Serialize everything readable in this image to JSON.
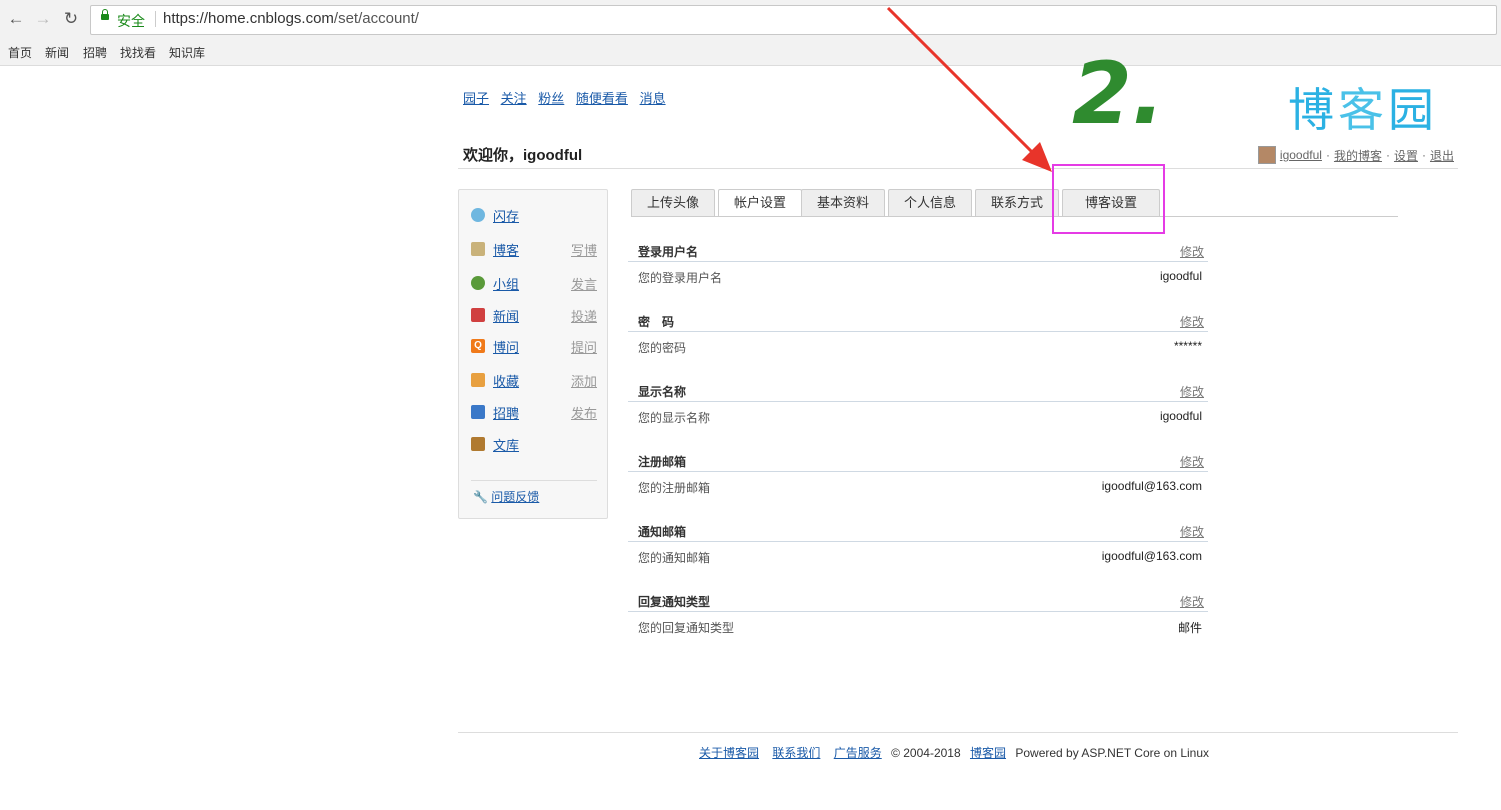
{
  "browser": {
    "secure_label": "安全",
    "url_host": "https://home.cnblogs.com",
    "url_path": "/set/account/",
    "bookmarks": [
      "首页",
      "新闻",
      "招聘",
      "找找看",
      "知识库"
    ]
  },
  "topnav": [
    "园子",
    "关注",
    "粉丝",
    "随便看看",
    "消息"
  ],
  "logo": {
    "chars": [
      "博",
      "客",
      "园"
    ],
    "color": "#2bb1e3"
  },
  "welcome": "欢迎你，igoodful",
  "user_links": {
    "username": "igoodful",
    "my_blog": "我的博客",
    "settings": "设置",
    "logout": "退出",
    "separator": "·"
  },
  "sidebar": {
    "items": [
      {
        "label": "闪存",
        "action": "",
        "icon": "chat-bubble-icon",
        "color": "#6fb7e0"
      },
      {
        "label": "博客",
        "action": "写博",
        "icon": "pencil-note-icon",
        "color": "#c9b27a"
      },
      {
        "label": "小组",
        "action": "发言",
        "icon": "group-icon",
        "color": "#5a9a3a"
      },
      {
        "label": "新闻",
        "action": "投递",
        "icon": "news-icon",
        "color": "#d04040"
      },
      {
        "label": "博问",
        "action": "提问",
        "icon": "question-icon",
        "color": "#f07a1a"
      },
      {
        "label": "收藏",
        "action": "添加",
        "icon": "heart-folder-icon",
        "color": "#e8a040"
      },
      {
        "label": "招聘",
        "action": "发布",
        "icon": "person-card-icon",
        "color": "#3a78c8"
      },
      {
        "label": "文库",
        "action": "",
        "icon": "book-icon",
        "color": "#b07a30"
      }
    ],
    "feedback": "问题反馈"
  },
  "tabs": [
    {
      "label": "上传头像",
      "active": false
    },
    {
      "label": "帐户设置",
      "active": true
    },
    {
      "label": "基本资料",
      "active": false
    },
    {
      "label": "个人信息",
      "active": false
    },
    {
      "label": "联系方式",
      "active": false
    },
    {
      "label": "博客设置",
      "active": false
    }
  ],
  "settings": [
    {
      "title": "登录用户名",
      "edit": "修改",
      "desc": "您的登录用户名",
      "value": "igoodful"
    },
    {
      "title": "密　码",
      "edit": "修改",
      "desc": "您的密码",
      "value": "******"
    },
    {
      "title": "显示名称",
      "edit": "修改",
      "desc": "您的显示名称",
      "value": "igoodful"
    },
    {
      "title": "注册邮箱",
      "edit": "修改",
      "desc": "您的注册邮箱",
      "value": "igoodful@163.com"
    },
    {
      "title": "通知邮箱",
      "edit": "修改",
      "desc": "您的通知邮箱",
      "value": "igoodful@163.com"
    },
    {
      "title": "回复通知类型",
      "edit": "修改",
      "desc": "您的回复通知类型",
      "value": "邮件"
    }
  ],
  "footer": {
    "about": "关于博客园",
    "contact": "联系我们",
    "ads": "广告服务",
    "copyright": "© 2004-2018",
    "site": "博客园",
    "powered": "Powered by ASP.NET Core on Linux"
  },
  "annotation": {
    "number": "2.",
    "highlight_color": "#e53be5",
    "arrow_color": "#e8342a"
  }
}
